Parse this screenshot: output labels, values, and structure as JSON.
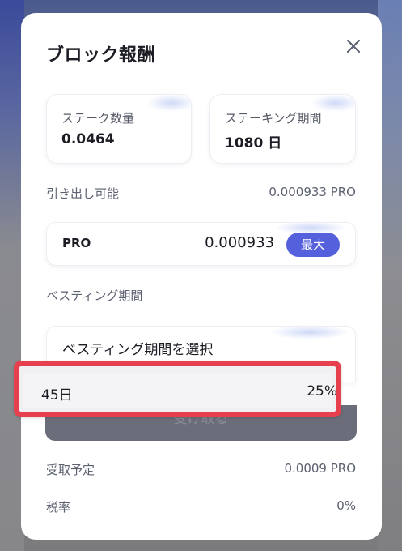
{
  "modal": {
    "title": "ブロック報酬",
    "close_icon": "close-icon"
  },
  "stats": {
    "stake_amount_label": "ステーク数量",
    "stake_amount_value": "0.0464",
    "stake_period_label": "ステーキング期間",
    "stake_period_value": "1080 日"
  },
  "withdrawable": {
    "label": "引き出し可能",
    "value": "0.000933 PRO"
  },
  "amount_input": {
    "token": "PRO",
    "value": "0.000933",
    "max_label": "最大"
  },
  "vesting": {
    "label": "ベスティング期間",
    "select_placeholder": "ベスティング期間を選択",
    "options": [
      {
        "label": "45日",
        "rate": "25%"
      }
    ]
  },
  "submit": {
    "label": "受け取る"
  },
  "summary": {
    "expected_label": "受取予定",
    "expected_value": "0.0009 PRO",
    "tax_label": "税率",
    "tax_value": "0%"
  },
  "colors": {
    "accent": "#5560dc",
    "highlight": "#e6404f",
    "button_disabled": "#6b6e7a"
  }
}
